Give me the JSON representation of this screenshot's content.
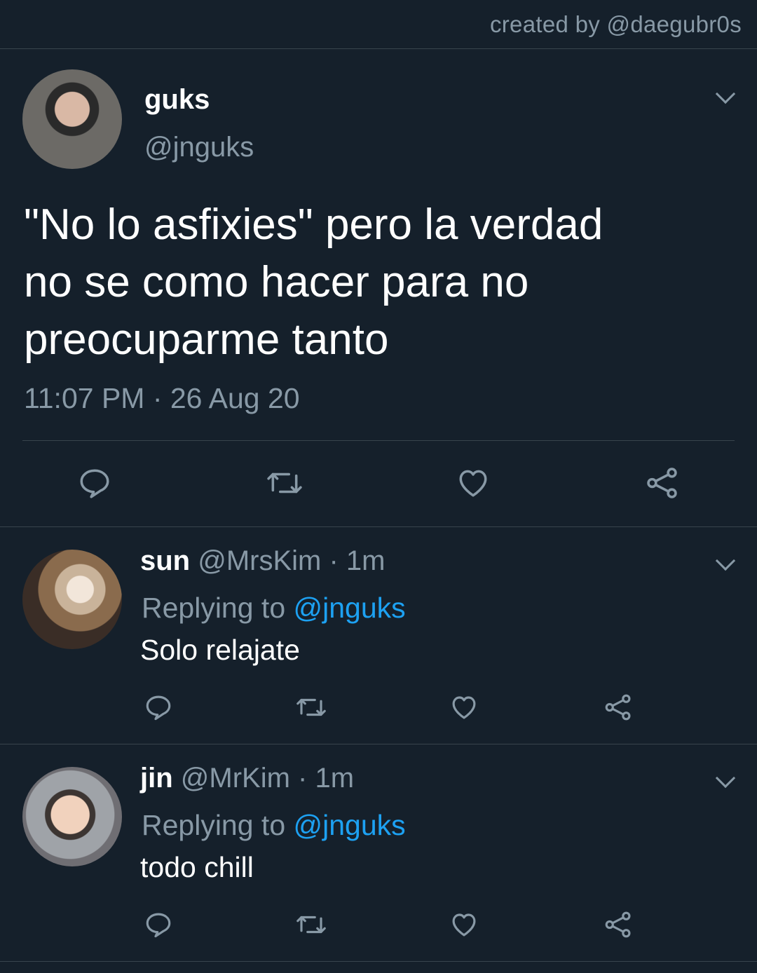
{
  "credit": "created by @daegubr0s",
  "main_tweet": {
    "name": "guks",
    "handle": "@jnguks",
    "text_lines": [
      "\"No lo asfixies\" pero la verdad",
      "no se como hacer para no",
      "preocuparme tanto"
    ],
    "timestamp": "11:07 PM · 26 Aug 20",
    "actions": [
      "reply-icon",
      "retweet-icon",
      "like-icon",
      "share-icon"
    ]
  },
  "replies": [
    {
      "name": "sun",
      "handle_time": " @MrsKim · 1m",
      "replying_prefix": "Replying to ",
      "replying_handle": "@jnguks",
      "text": "Solo relajate"
    },
    {
      "name": "jin",
      "handle_time": " @MrKim · 1m",
      "replying_prefix": "Replying to ",
      "replying_handle": "@jnguks",
      "text": "todo chill"
    }
  ],
  "colors": {
    "background": "#15202b",
    "secondary_text": "#8899a6",
    "link": "#1da1f2",
    "divider": "#38444d"
  }
}
